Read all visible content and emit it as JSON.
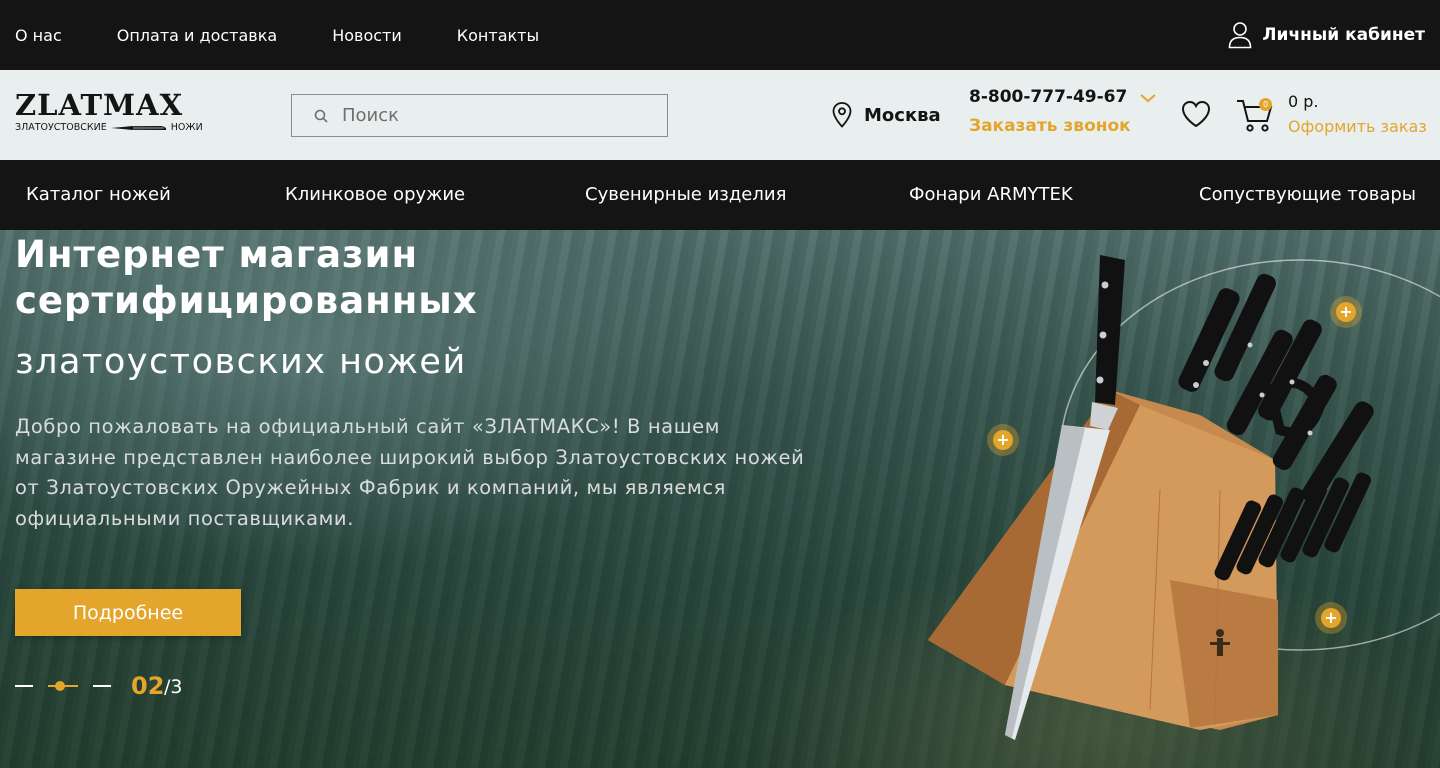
{
  "topbar": {
    "nav": [
      "О нас",
      "Оплата и доставка",
      "Новости",
      "Контакты"
    ],
    "cabinet_label": "Личный кабинет"
  },
  "header": {
    "logo_word": "ZLATMAX",
    "logo_sub_left": "ЗЛАТОУСТОВСКИЕ",
    "logo_sub_right": "НОЖИ",
    "search_placeholder": "Поиск",
    "city": "Москва",
    "phone": "8-800-777-49-67",
    "callback": "Заказать звонок",
    "cart_count": "0",
    "cart_sum": "0 р.",
    "order": "Оформить заказ"
  },
  "mainnav": [
    "Каталог ножей",
    "Клинковое оружие",
    "Сувенирные изделия",
    "Фонари ARMYTEK",
    "Сопуствующие товары"
  ],
  "hero": {
    "title_line1": "Интернет магазин",
    "title_line2": "сертифицированных",
    "title_line3": "златоустовских ножей",
    "description": "Добро пожаловать на официальный сайт «ЗЛАТМАКС»! В нашем магазине представлен наиболее широкий выбор Златоустовских ножей от Златоустовских Оружейных Фабрик и компаний, мы являемся официальными поставщиками.",
    "button": "Подробнее",
    "slide_current": "02",
    "slide_total": "/3"
  },
  "colors": {
    "accent": "#e3a52c",
    "dark": "#141414",
    "header_bg": "#e9eeee"
  }
}
